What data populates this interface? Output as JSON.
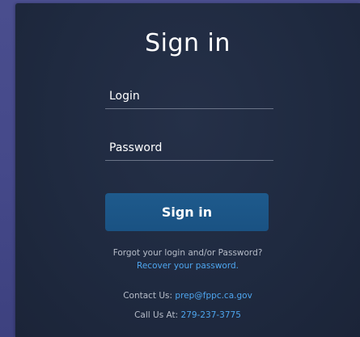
{
  "signin": {
    "title": "Sign in",
    "login_placeholder": "Login",
    "password_placeholder": "Password",
    "button_label": "Sign in"
  },
  "help": {
    "forgot_text": "Forgot your login and/or Password?",
    "recover_link": "Recover your password.",
    "contact_label": "Contact Us:",
    "contact_email": "prep@fppc.ca.gov",
    "call_label": "Call Us At:",
    "call_phone": "279-237-3775"
  },
  "colors": {
    "background": "#45498a",
    "card": "#1f2a40",
    "button": "#1d5789",
    "link": "#4ea6ef"
  }
}
